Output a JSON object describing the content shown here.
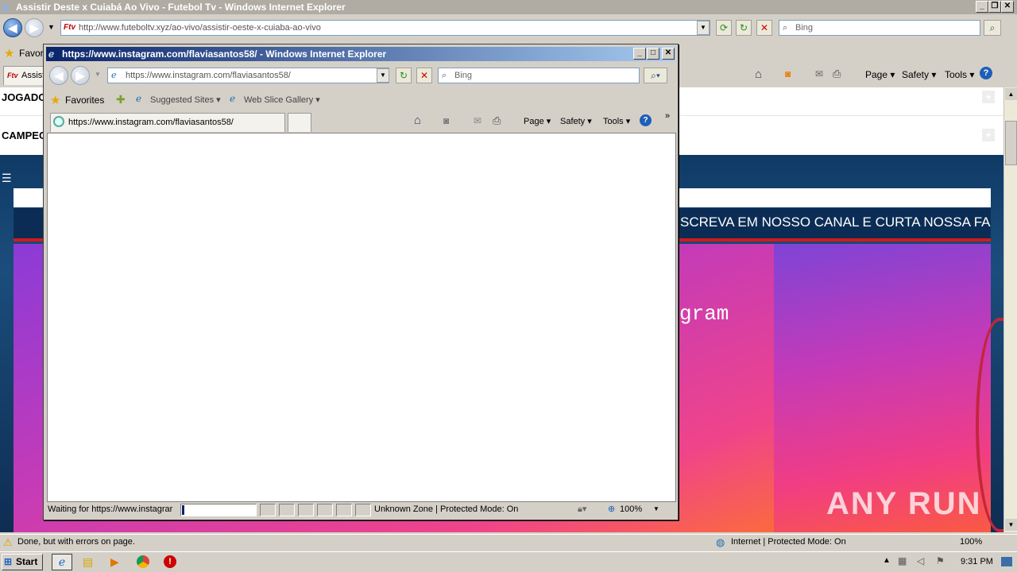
{
  "main_window": {
    "title": "Assistir Deste x Cuiabá Ao Vivo - Futebol Tv - Windows Internet Explorer",
    "address": "http://www.futeboltv.xyz/ao-vivo/assistir-oeste-x-cuiaba-ao-vivo",
    "search_placeholder": "Bing",
    "favorites_label": "Favori",
    "tab_label": "Assist",
    "cmd_page": "Page ▾",
    "cmd_safety": "Safety ▾",
    "cmd_tools": "Tools ▾",
    "status_text": "Done, but with errors on page.",
    "zone_text": "Internet | Protected Mode: On",
    "zoom": "100%"
  },
  "site": {
    "menu1": "JOGADO",
    "menu2": "CAMPEO",
    "marquee": "SCREVA EM NOSSO CANAL E CURTA NOSSA FAN",
    "ig_text": "gram"
  },
  "popup": {
    "title": "https://www.instagram.com/flaviasantos58/ - Windows Internet Explorer",
    "address": "https://www.instagram.com/flaviasantos58/",
    "search_placeholder": "Bing",
    "favorites_label": "Favorites",
    "suggested_sites": "Suggested Sites ▾",
    "web_slice_gallery": "Web Slice Gallery ▾",
    "tab_label": "https://www.instagram.com/flaviasantos58/",
    "cmd_page": "Page ▾",
    "cmd_safety": "Safety ▾",
    "cmd_tools": "Tools ▾",
    "status_waiting": "Waiting for https://www.instagrar",
    "zone_text": "Unknown Zone | Protected Mode: On",
    "zoom": "100%"
  },
  "taskbar": {
    "start_label": "Start",
    "clock": "9:31 PM"
  },
  "watermark": "ANY RUN"
}
